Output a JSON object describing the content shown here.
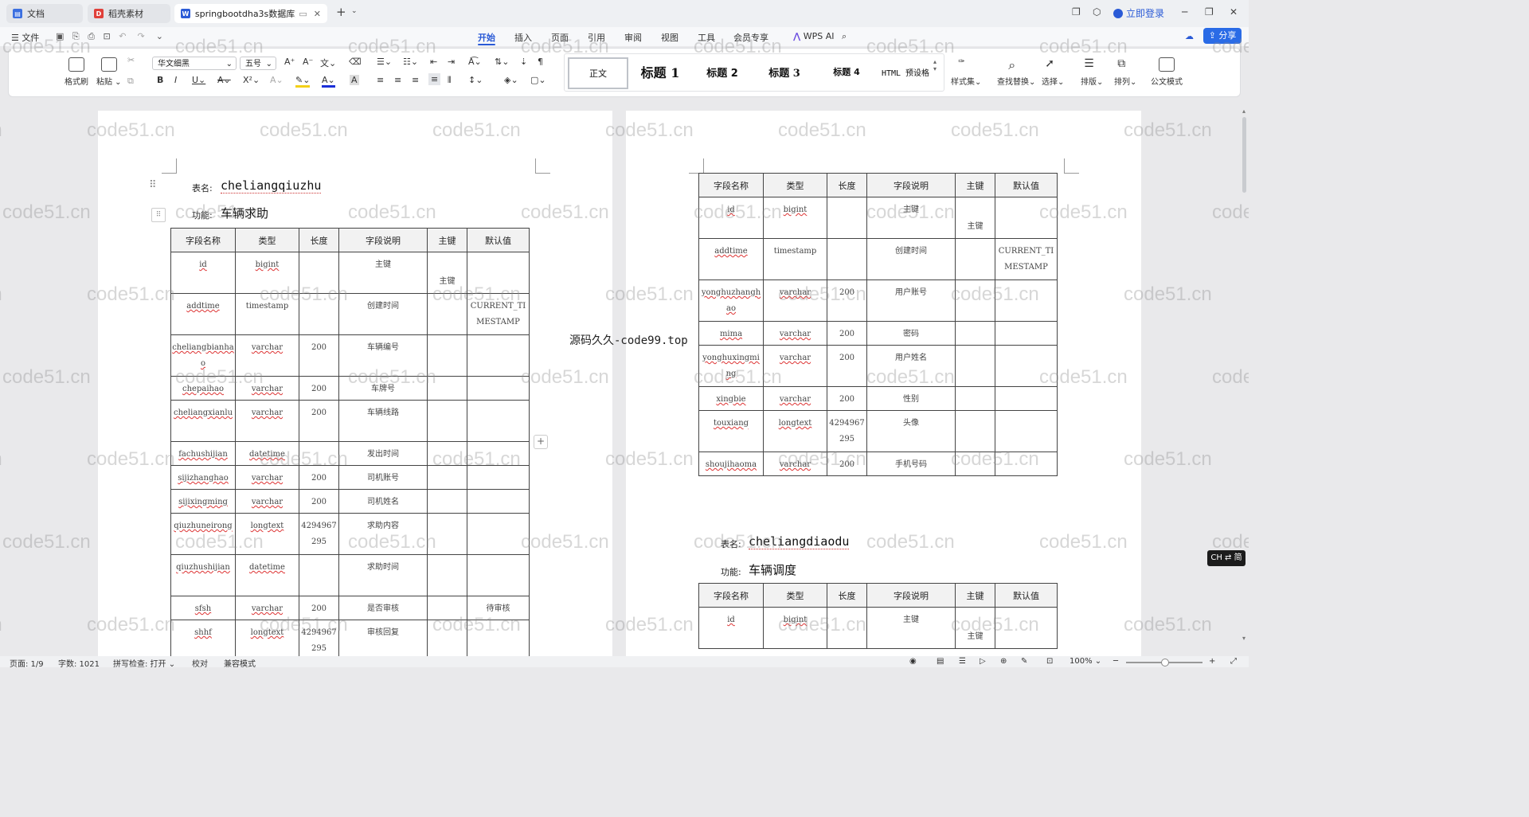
{
  "tabs": [
    {
      "label": "文档",
      "icon": "document-icon"
    },
    {
      "label": "稻壳素材",
      "icon": "docer-icon"
    },
    {
      "label": "springbootdha3s数据库文",
      "icon": "word-icon"
    }
  ],
  "title_right": {
    "login": "立即登录"
  },
  "menu": {
    "file": "文件",
    "items": [
      "开始",
      "插入",
      "页面",
      "引用",
      "审阅",
      "视图",
      "工具",
      "会员专享"
    ],
    "wps_ai": "WPS AI",
    "share": "分享"
  },
  "ribbon": {
    "format_painter": "格式刷",
    "paste": "粘贴",
    "font_name": "华文细黑",
    "font_size": "五号",
    "styles": [
      "正文",
      "标题 1",
      "标题 2",
      "标题 3",
      "标题 4",
      "HTML 预设格"
    ],
    "style_set": "样式集",
    "find_replace": "查找替换",
    "select": "选择",
    "layout": "排版",
    "arrange": "排列",
    "official": "公文模式"
  },
  "watermark": "code51.cn",
  "center_watermark": "源码久久-code99.top",
  "labels": {
    "table_name": "表名:",
    "function": "功能:"
  },
  "headers": [
    "字段名称",
    "类型",
    "长度",
    "字段说明",
    "主键",
    "默认值"
  ],
  "left_table": {
    "name": "cheliangqiuzhu",
    "function": "车辆求助",
    "rows": [
      {
        "f": "id",
        "t": "bigint",
        "l": "",
        "d": "主键",
        "k": "主键",
        "v": ""
      },
      {
        "f": "addtime",
        "t": "timestamp",
        "l": "",
        "d": "创建时间",
        "k": "",
        "v": "CURRENT_TIMESTAMP"
      },
      {
        "f": "cheliangbianhao",
        "t": "varchar",
        "l": "200",
        "d": "车辆编号",
        "k": "",
        "v": ""
      },
      {
        "f": "chepaihao",
        "t": "varchar",
        "l": "200",
        "d": "车牌号",
        "k": "",
        "v": ""
      },
      {
        "f": "cheliangxianlu",
        "t": "varchar",
        "l": "200",
        "d": "车辆线路",
        "k": "",
        "v": ""
      },
      {
        "f": "fachushijian",
        "t": "datetime",
        "l": "",
        "d": "发出时间",
        "k": "",
        "v": ""
      },
      {
        "f": "sijizhanghao",
        "t": "varchar",
        "l": "200",
        "d": "司机账号",
        "k": "",
        "v": ""
      },
      {
        "f": "sijixingming",
        "t": "varchar",
        "l": "200",
        "d": "司机姓名",
        "k": "",
        "v": ""
      },
      {
        "f": "qiuzhuneirong",
        "t": "longtext",
        "l": "4294967295",
        "d": "求助内容",
        "k": "",
        "v": ""
      },
      {
        "f": "qiuzhushijian",
        "t": "datetime",
        "l": "",
        "d": "求助时间",
        "k": "",
        "v": ""
      },
      {
        "f": "sfsh",
        "t": "varchar",
        "l": "200",
        "d": "是否审核",
        "k": "",
        "v": "待审核"
      },
      {
        "f": "shhf",
        "t": "longtext",
        "l": "4294967295",
        "d": "审核回复",
        "k": "",
        "v": ""
      }
    ]
  },
  "right_table1": {
    "rows": [
      {
        "f": "id",
        "t": "bigint",
        "l": "",
        "d": "主键",
        "k": "主键",
        "v": ""
      },
      {
        "f": "addtime",
        "t": "timestamp",
        "l": "",
        "d": "创建时间",
        "k": "",
        "v": "CURRENT_TIMESTAMP"
      },
      {
        "f": "yonghuzhanghao",
        "t": "varchar",
        "l": "200",
        "d": "用户账号",
        "k": "",
        "v": ""
      },
      {
        "f": "mima",
        "t": "varchar",
        "l": "200",
        "d": "密码",
        "k": "",
        "v": ""
      },
      {
        "f": "yonghuxingming",
        "t": "varchar",
        "l": "200",
        "d": "用户姓名",
        "k": "",
        "v": ""
      },
      {
        "f": "xingbie",
        "t": "varchar",
        "l": "200",
        "d": "性别",
        "k": "",
        "v": ""
      },
      {
        "f": "touxiang",
        "t": "longtext",
        "l": "4294967295",
        "d": "头像",
        "k": "",
        "v": ""
      },
      {
        "f": "shoujihaoma",
        "t": "varchar",
        "l": "200",
        "d": "手机号码",
        "k": "",
        "v": ""
      }
    ]
  },
  "right_table2": {
    "name": "cheliangdiaodu",
    "function": "车辆调度",
    "rows": [
      {
        "f": "id",
        "t": "bigint",
        "l": "",
        "d": "主键",
        "k": "主键",
        "v": ""
      }
    ]
  },
  "ime": "CH ⇄ 简",
  "status": {
    "page": "页面: 1/9",
    "words": "字数: 1021",
    "spell": "拼写检查: 打开",
    "proof": "校对",
    "compat": "兼容模式",
    "zoom": "100%"
  }
}
